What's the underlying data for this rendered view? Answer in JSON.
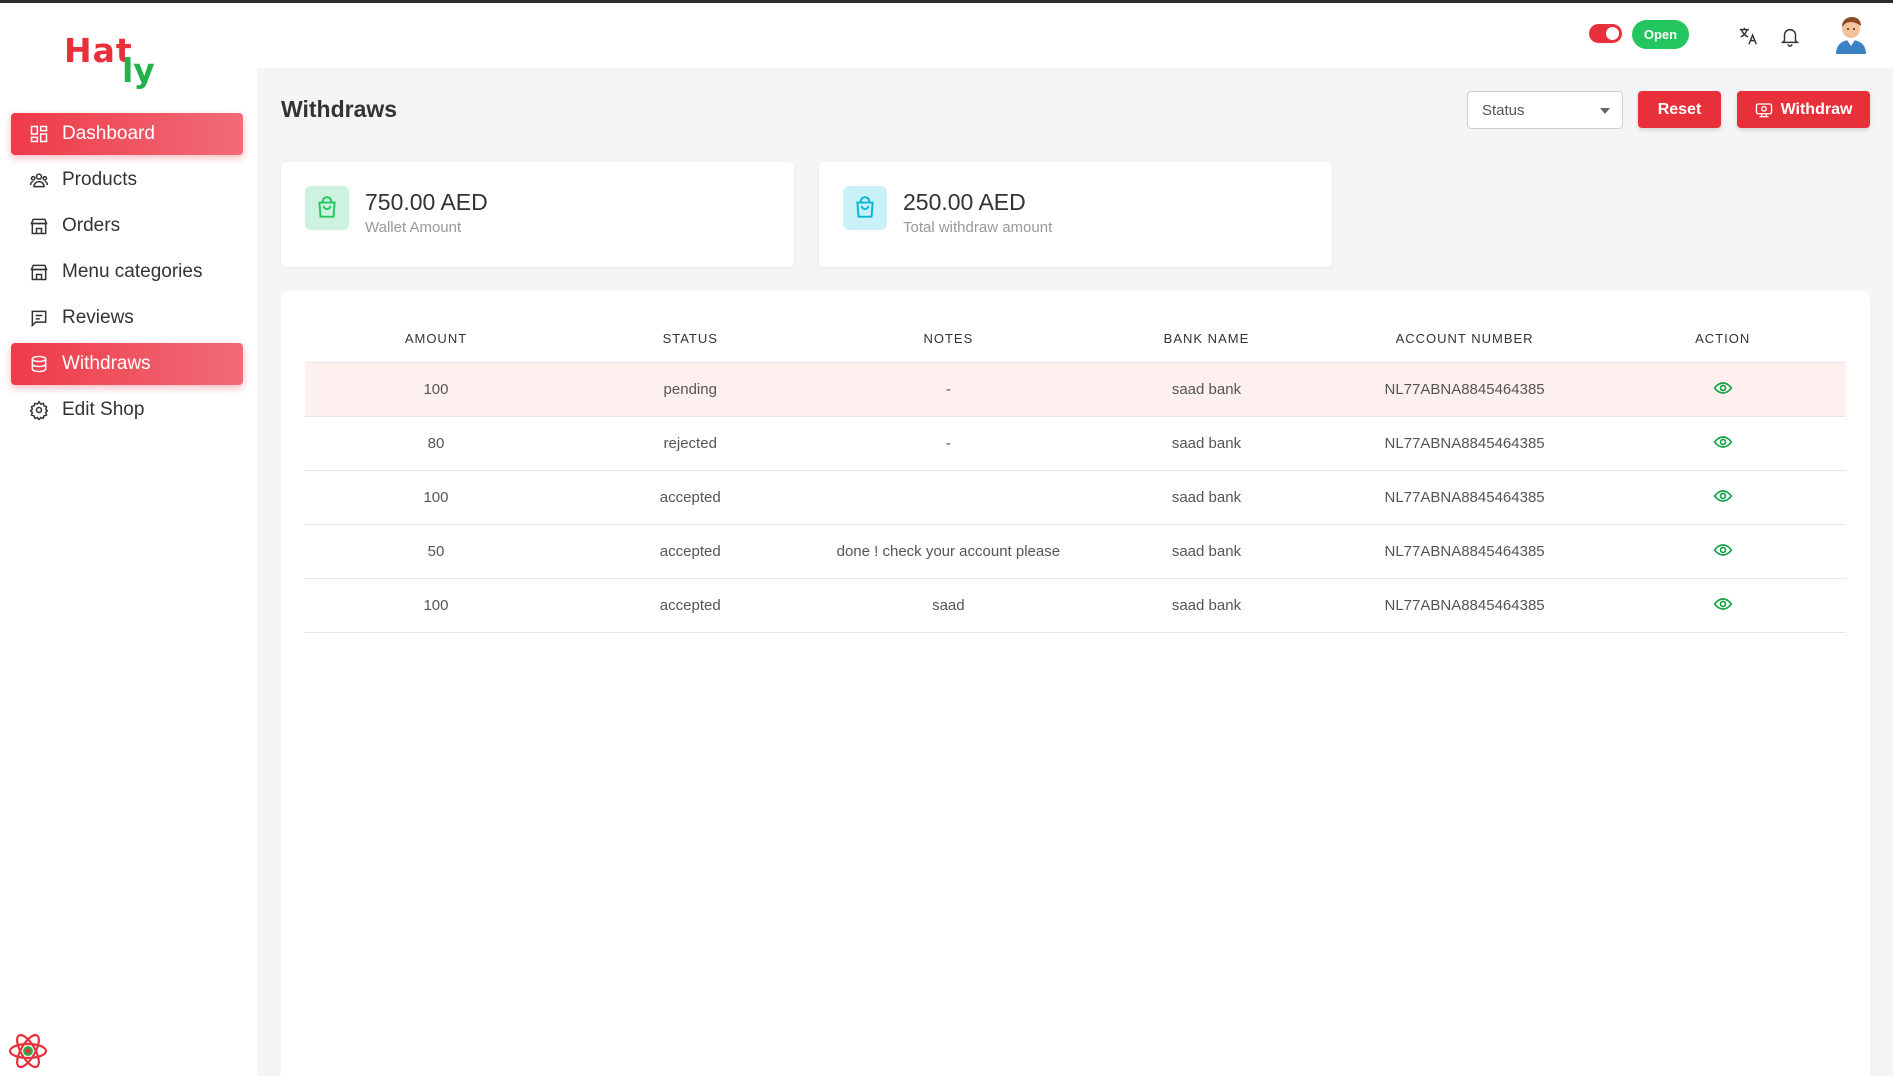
{
  "brand": {
    "logo_text_1": "Hat",
    "logo_text_2": "ly",
    "red": "#e8303a",
    "green": "#22b14c"
  },
  "sidebar": {
    "items": [
      {
        "label": "Dashboard",
        "icon": "dashboard-icon",
        "active": true
      },
      {
        "label": "Products",
        "icon": "users-icon",
        "active": false
      },
      {
        "label": "Orders",
        "icon": "store-icon",
        "active": false
      },
      {
        "label": "Menu categories",
        "icon": "store-icon",
        "active": false
      },
      {
        "label": "Reviews",
        "icon": "reviews-icon",
        "active": false
      },
      {
        "label": "Withdraws",
        "icon": "coins-icon",
        "active": true
      },
      {
        "label": "Edit Shop",
        "icon": "gear-icon",
        "active": false
      }
    ]
  },
  "header": {
    "open_label": "Open",
    "toggle_on": true
  },
  "page": {
    "title": "Withdraws",
    "status_placeholder": "Status",
    "reset_label": "Reset",
    "withdraw_label": "Withdraw"
  },
  "cards": [
    {
      "amount": "750.00 AED",
      "label": "Wallet Amount",
      "icon": "shopping-bag-icon",
      "color": "#22c55e"
    },
    {
      "amount": "250.00 AED",
      "label": "Total withdraw amount",
      "icon": "shopping-bag-icon",
      "color": "#06b6d4"
    }
  ],
  "table": {
    "columns": [
      "AMOUNT",
      "STATUS",
      "NOTES",
      "BANK NAME",
      "ACCOUNT NUMBER",
      "ACTION"
    ],
    "rows": [
      {
        "amount": "100",
        "status": "pending",
        "notes": "-",
        "bank": "saad bank",
        "account": "NL77ABNA8845464385"
      },
      {
        "amount": "80",
        "status": "rejected",
        "notes": "-",
        "bank": "saad bank",
        "account": "NL77ABNA8845464385"
      },
      {
        "amount": "100",
        "status": "accepted",
        "notes": "",
        "bank": "saad bank",
        "account": "NL77ABNA8845464385"
      },
      {
        "amount": "50",
        "status": "accepted",
        "notes": "done ! check your account please",
        "bank": "saad bank",
        "account": "NL77ABNA8845464385"
      },
      {
        "amount": "100",
        "status": "accepted",
        "notes": "saad",
        "bank": "saad bank",
        "account": "NL77ABNA8845464385"
      }
    ],
    "action_icon": "eye-icon"
  }
}
